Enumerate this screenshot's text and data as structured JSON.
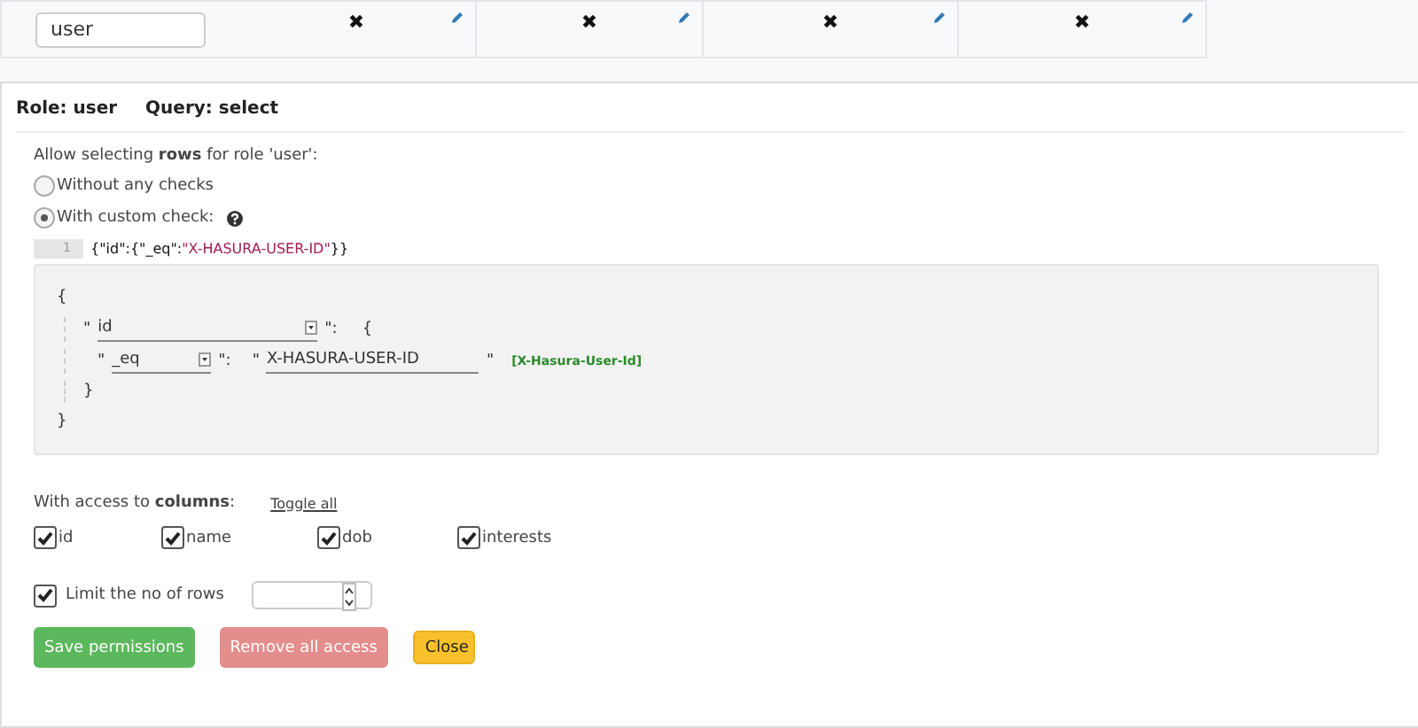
{
  "role_row": {
    "role_input": "user",
    "cells": [
      {
        "symbol": "✖"
      },
      {
        "symbol": "✖"
      },
      {
        "symbol": "✖"
      },
      {
        "symbol": "✖"
      }
    ]
  },
  "panel": {
    "role": "Role: user",
    "query": "Query: select",
    "intro": "Allow selecting **rows** for role 'user':",
    "radios": [
      {
        "label": "Without any checks",
        "selected": false,
        "help": false
      },
      {
        "label": "With custom check:",
        "selected": true,
        "help": true
      }
    ],
    "code_line": {
      "number": "1",
      "segments": [
        {
          "kind": "punct",
          "text": "{\"id\":{\"_eq\":"
        },
        {
          "kind": "string",
          "text": "\"X-HASURA-USER-ID\""
        },
        {
          "kind": "punct",
          "text": "}}"
        }
      ]
    },
    "builder": {
      "open": "{",
      "column_quote": "\"",
      "column": "id",
      "column_after": "\":",
      "column_brace": "{",
      "op_quote": "\"",
      "operator": "_eq",
      "op_after": "\":",
      "value_quote": "\"",
      "value": "X-HASURA-USER-ID",
      "value_close": "\"",
      "hint": "[X-Hasura-User-Id]",
      "inner_close": "}",
      "close": "}"
    },
    "columns_label": "With access to **columns**:",
    "toggle_all": "Toggle all",
    "columns": [
      {
        "label": "id",
        "checked": true
      },
      {
        "label": "name",
        "checked": true
      },
      {
        "label": "dob",
        "checked": true
      },
      {
        "label": "interests",
        "checked": true
      }
    ],
    "limit": {
      "label": "Limit the no of rows",
      "checked": true
    },
    "buttons": [
      {
        "label": "Save permissions",
        "kind": "save"
      },
      {
        "label": "Remove all access",
        "kind": "remove"
      },
      {
        "label": "Close",
        "kind": "close"
      }
    ]
  }
}
